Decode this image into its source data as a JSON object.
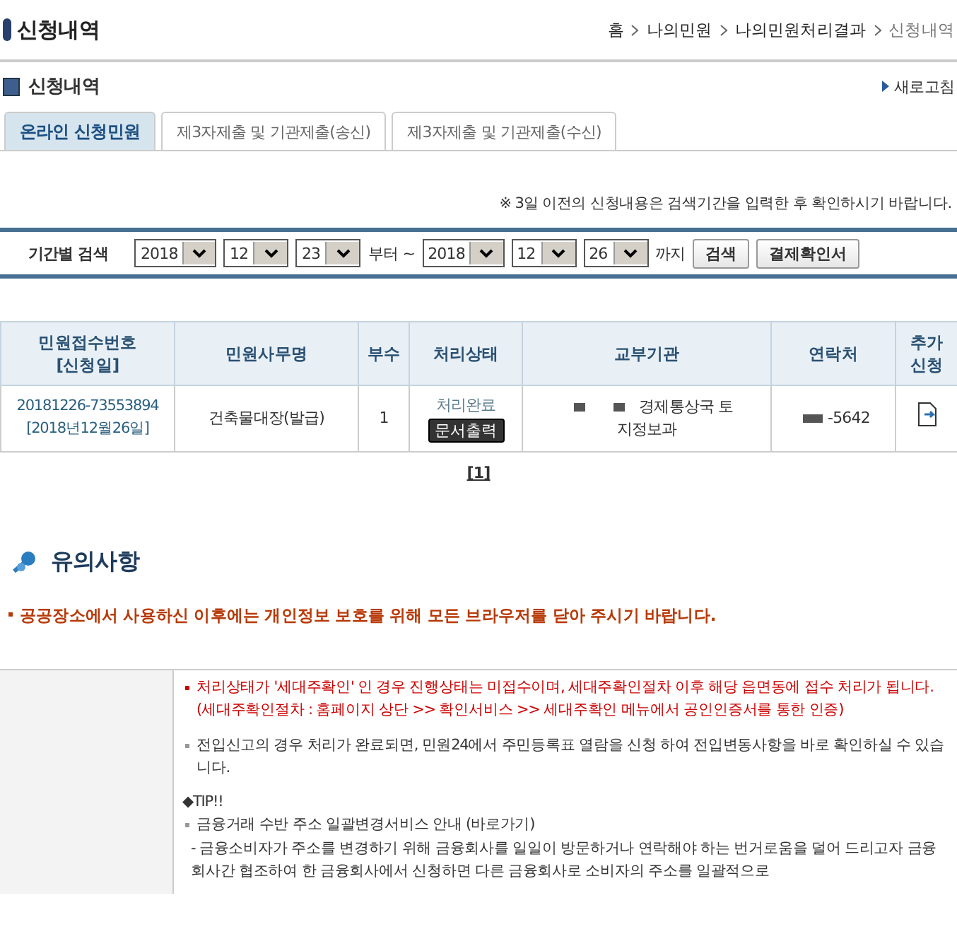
{
  "page_title": "신청내역",
  "breadcrumb": [
    {
      "label": "홈",
      "current": false
    },
    {
      "label": "나의민원",
      "current": false
    },
    {
      "label": "나의민원처리결과",
      "current": false
    },
    {
      "label": "신청내역",
      "current": true
    }
  ],
  "section_title": "신청내역",
  "refresh_link": "새로고침",
  "tabs": [
    {
      "label": "온라인 신청민원",
      "selected": true
    },
    {
      "label": "제3자제출 및 기관제출(송신)",
      "selected": false
    },
    {
      "label": "제3자제출 및 기관제출(수신)",
      "selected": false
    }
  ],
  "notice": "※ 3일 이전의 신청내용은 검색기간을 입력한 후 확인하시기 바랍니다.",
  "search": {
    "label": "기간별 검색",
    "from": [
      "2018",
      "12",
      "23"
    ],
    "from_suffix": "부터 ~",
    "to": [
      "2018",
      "12",
      "26"
    ],
    "to_suffix": "까지",
    "buttons": [
      "검색",
      "결제확인서"
    ]
  },
  "table": {
    "columns": [
      [
        "민원접수번호",
        "[신청일]"
      ],
      [
        "민원사무명"
      ],
      [
        "부수"
      ],
      [
        "처리상태"
      ],
      [
        "교부기관"
      ],
      [
        "연락처"
      ],
      [
        "추가",
        "신청"
      ]
    ],
    "rows": [
      {
        "receipt_no": "20181226-73553894",
        "date": "[2018년12월26일]",
        "name": "건축물대장(발급)",
        "copies": "1",
        "status": "처리완료",
        "print_button": "문서출력",
        "agency": [
          "경제통상국 토",
          "지정보과"
        ],
        "contact": "-5642"
      }
    ]
  },
  "pages": [
    "[1]"
  ],
  "caution_title": "유의사항",
  "caution_text": "공공장소에서 사용하신 이후에는 개인정보 보호를 위해 모든 브라우저를 닫아 주시기 바랍니다.",
  "info": [
    {
      "kind": "alert",
      "text": "처리상태가 '세대주확인' 인 경우 진행상태는 미접수이며, 세대주확인절차 이후 해당 읍면동에 접수 처리가 됩니다. (세대주확인절차 : 홈페이지 상단 >> 확인서비스 >> 세대주확인 메뉴에서 공인인증서를 통한 인증)"
    },
    {
      "kind": "bullet",
      "text": "전입신고의 경우 처리가 완료되면, 민원24에서 주민등록표 열람을 신청 하여 전입변동사항을 바로 확인하실 수 있습니다."
    },
    {
      "kind": "heading",
      "text": "◆TIP!!"
    },
    {
      "kind": "bullet",
      "text": "금융거래 수반 주소 일괄변경서비스 안내 (바로가기)"
    },
    {
      "kind": "plain",
      "text": "-  금융소비자가 주소를 변경하기 위해 금융회사를 일일이 방문하거나 연락해야 하는 번거로움을 덜어 드리고자 금융회사간 협조하여 한 금융회사에서 신청하면 다른 금융회사로 소비자의 주소를 일괄적으로"
    }
  ]
}
